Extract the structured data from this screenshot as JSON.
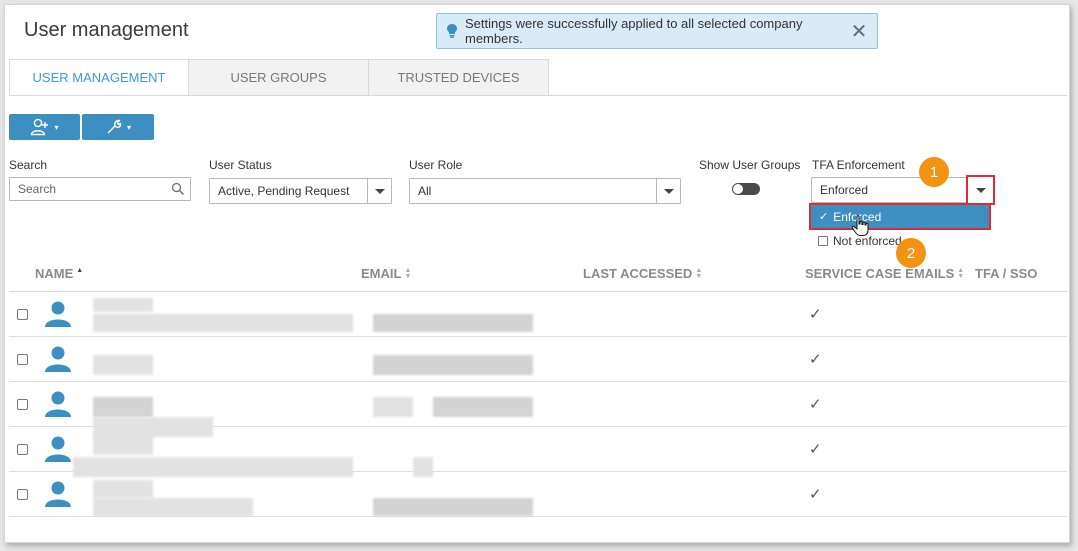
{
  "page": {
    "title": "User management"
  },
  "toast": {
    "message": "Settings were successfully applied to all selected company members.",
    "close_glyph": "✕"
  },
  "tabs": [
    {
      "label": "USER MANAGEMENT",
      "active": true
    },
    {
      "label": "USER GROUPS",
      "active": false
    },
    {
      "label": "TRUSTED DEVICES",
      "active": false
    }
  ],
  "toolbar": {
    "caret": "▾"
  },
  "filters": {
    "search": {
      "label": "Search",
      "placeholder": "Search"
    },
    "user_status": {
      "label": "User Status",
      "value": "Active, Pending Request"
    },
    "user_role": {
      "label": "User Role",
      "value": "All"
    },
    "show_user_groups": {
      "label": "Show User Groups",
      "on": false
    },
    "tfa": {
      "label": "TFA Enforcement",
      "value": "Enforced",
      "options": [
        {
          "label": "Enforced",
          "checked": true,
          "check_glyph": "✓"
        },
        {
          "label": "Not enforced",
          "checked": false
        }
      ]
    }
  },
  "annotations": {
    "step1": "1",
    "step2": "2"
  },
  "table": {
    "columns": [
      "NAME",
      "EMAIL",
      "LAST ACCESSED",
      "SERVICE CASE EMAILS",
      "TFA / SSO"
    ],
    "check_glyph": "✓",
    "rows": [
      {
        "service_case_emails": true
      },
      {
        "service_case_emails": true
      },
      {
        "service_case_emails": true
      },
      {
        "service_case_emails": true
      },
      {
        "service_case_emails": true
      }
    ]
  },
  "colors": {
    "accent": "#3d8fc1",
    "tab_active": "#3d9bd1",
    "annotation": "#f39313",
    "highlight": "#e02b35",
    "toast_bg": "#d7ecf7"
  }
}
